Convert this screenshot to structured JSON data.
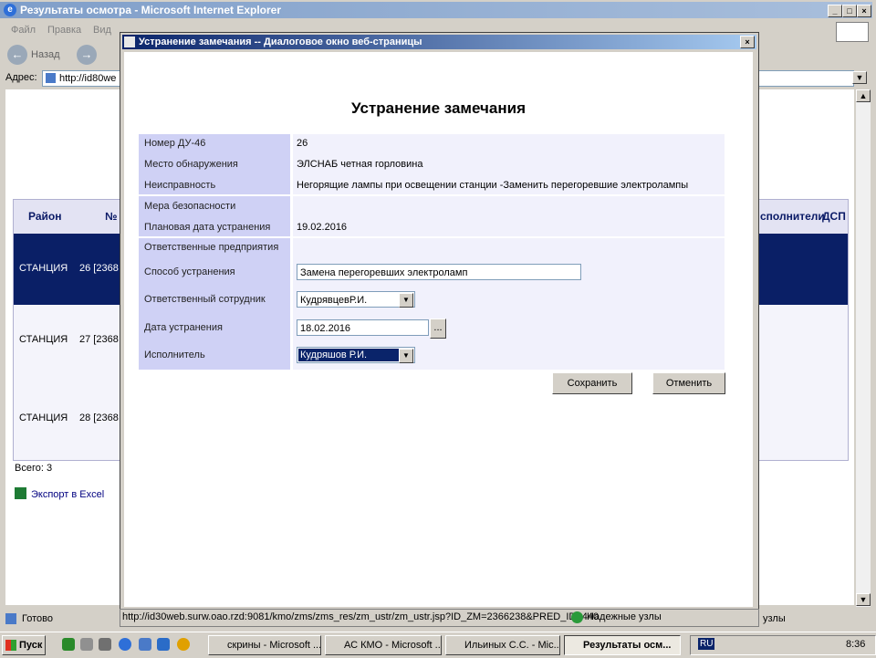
{
  "ie": {
    "title": "Результаты осмотра - Microsoft Internet Explorer",
    "menu": [
      "Файл",
      "Правка",
      "Вид"
    ],
    "back_label": "Назад",
    "address_label": "Адрес:",
    "address_value": "http://id80we",
    "status": "Готово",
    "zone": "узлы",
    "table": {
      "headers": {
        "district": "Район",
        "num": "№",
        "executors": "сполнители",
        "dsp": "ДСП"
      },
      "rows": [
        {
          "district": "СТАНЦИЯ",
          "num": "26 [2368"
        },
        {
          "district": "СТАНЦИЯ",
          "num": "27 [2368"
        },
        {
          "district": "СТАНЦИЯ",
          "num": "28 [2368"
        }
      ]
    },
    "total": "Всего: 3",
    "export": "Экспорт в Excel"
  },
  "dialog": {
    "title": "Устранение замечания -- Диалоговое окно веб-страницы",
    "heading": "Устранение замечания",
    "fields": {
      "du46_label": "Номер ДУ-46",
      "du46_value": "26",
      "place_label": "Место обнаружения",
      "place_value": "ЭЛСНАБ четная горловина",
      "fault_label": "Неисправность",
      "fault_value": "Негорящие лампы при освещении станции -Заменить перегоревшие электролампы",
      "safety_label": "Мера безопасности",
      "plan_label": "Плановая дата устранения",
      "plan_value": "19.02.2016",
      "resp_ent_label": "Ответственные предприятия",
      "method_label": "Способ устранения",
      "method_value": "Замена перегоревших электроламп",
      "employee_label": "Ответственный сотрудник",
      "employee_value": "КудрявцевР.И.",
      "date_label": "Дата устранения",
      "date_value": "18.02.2016",
      "date_btn": "...",
      "executor_label": "Исполнитель",
      "executor_value": "Кудряшов Р.И."
    },
    "save": "Сохранить",
    "cancel": "Отменить",
    "status_url": "http://id30web.surw.oao.rzd:9081/kmo/zms/zms_res/zm_ustr/zm_ustr.jsp?ID_ZM=2366238&PRED_ID=440",
    "status_zone": "Надежные узлы"
  },
  "taskbar": {
    "start": "Пуск",
    "items": [
      "скрины - Microsoft ...",
      "АС КМО - Microsoft ...",
      "Ильиных С.С. - Mic...",
      "Результаты осм..."
    ],
    "lang": "RU",
    "clock": "8:36"
  }
}
